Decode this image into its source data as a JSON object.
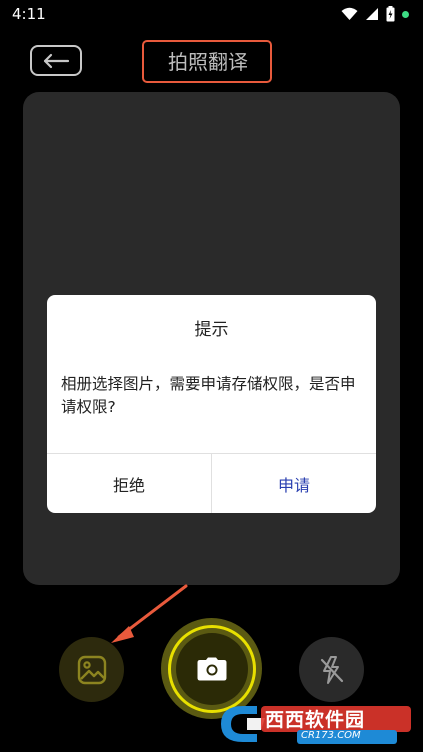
{
  "status_bar": {
    "time": "4:11"
  },
  "header": {
    "title": "拍照翻译"
  },
  "dialog": {
    "title": "提示",
    "message": "相册选择图片，需要申请存储权限，是否申请权限?",
    "cancel_label": "拒绝",
    "confirm_label": "申请"
  },
  "controls": {
    "gallery_icon": "image-icon",
    "shutter_icon": "camera-icon",
    "flash_icon": "flash-off-icon"
  },
  "colors": {
    "accent_yellow": "#e8e000",
    "annotation_red": "#e85a3c",
    "confirm_blue": "#2a3fb0"
  },
  "watermark": {
    "brand": "西西软件园",
    "url": "CR173.COM"
  }
}
